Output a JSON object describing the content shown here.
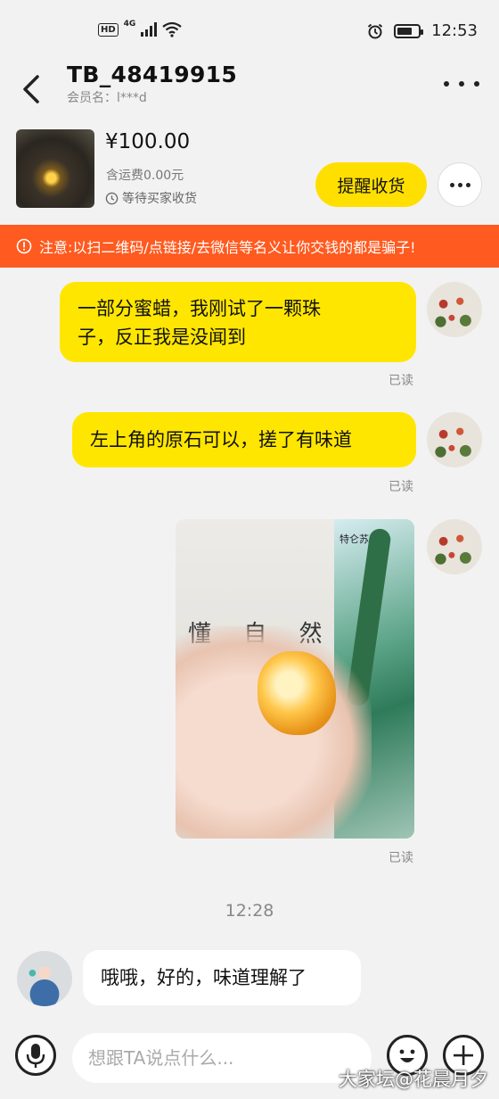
{
  "status_bar": {
    "hd": "HD",
    "network": "4G",
    "time": "12:53",
    "battery_level": 0.72
  },
  "header": {
    "title": "TB_48419915",
    "subtitle": "会员名：l***d"
  },
  "order": {
    "price": "¥100.00",
    "shipping": "含运费0.00元",
    "status": "等待买家收货",
    "remind_label": "提醒收货"
  },
  "warning": {
    "text": "注意:以扫二维码/点链接/去微信等名义让你交钱的都是骗子!"
  },
  "messages": {
    "m1": {
      "line1": "一部分蜜蜡，我刚试了一颗珠",
      "line2": "子，反正我是没闻到",
      "status": "已读"
    },
    "m2": {
      "text": "左上角的原石可以，搓了有味道",
      "status": "已读"
    },
    "m3": {
      "image_text": "懂 自 然",
      "image_brand": "特仑苏",
      "status": "已读"
    },
    "time_separator": "12:28",
    "m4": {
      "text": "哦哦，好的，味道理解了"
    }
  },
  "input": {
    "placeholder": "想跟TA说点什么..."
  },
  "watermark": "大家坛@花晨月夕",
  "colors": {
    "accent_yellow": "#ffe600",
    "warning_orange": "#ff5a1f"
  }
}
